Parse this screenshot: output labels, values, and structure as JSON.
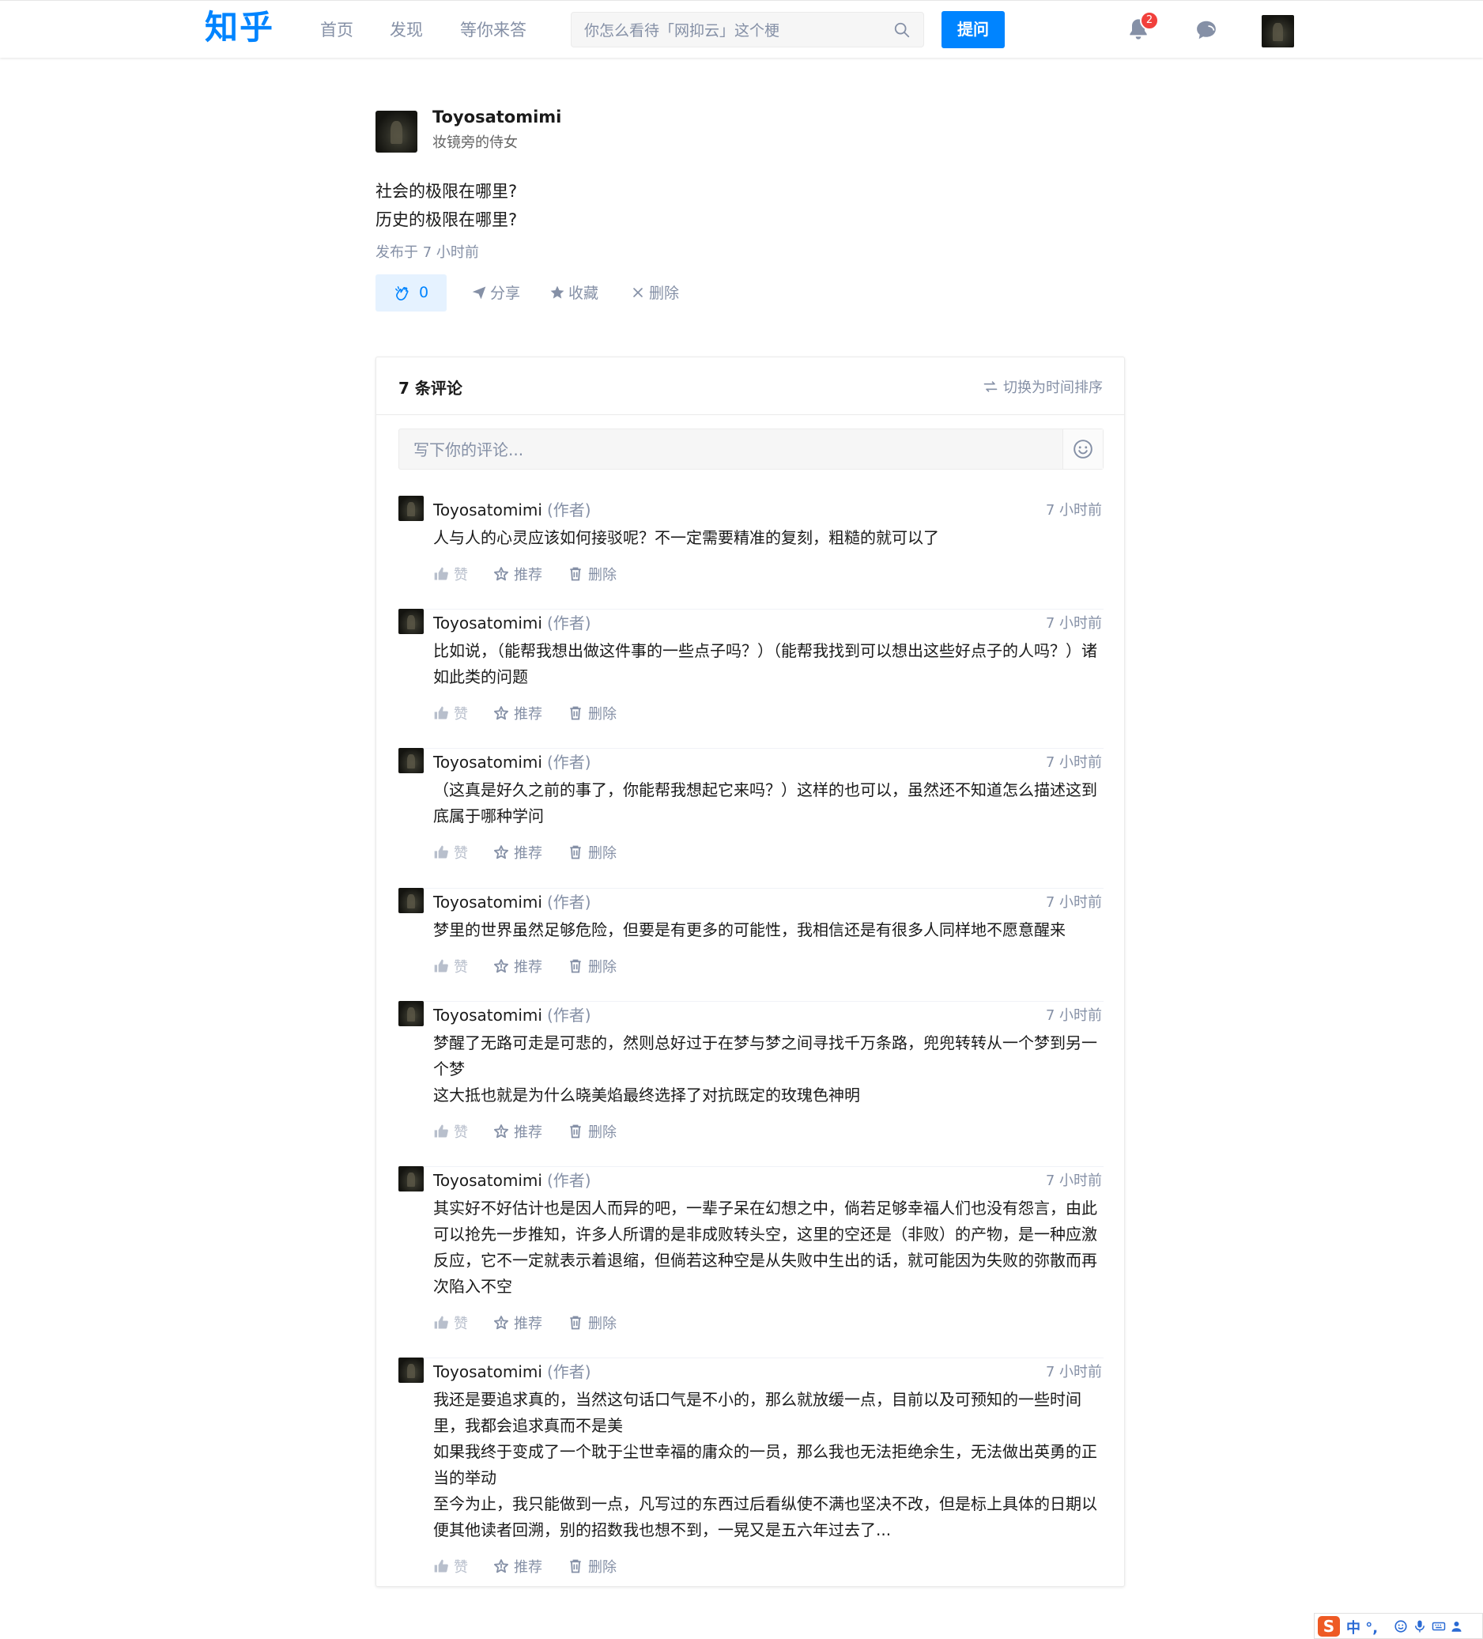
{
  "nav": {
    "logo": "知乎",
    "links": [
      "首页",
      "发现",
      "等你来答"
    ],
    "search_placeholder": "你怎么看待「网抑云」这个梗",
    "ask_label": "提问",
    "notification_count": "2"
  },
  "post": {
    "author": "Toyosatomimi",
    "headline": "妆镜旁的侍女",
    "lines": [
      "社会的极限在哪里?",
      "历史的极限在哪里?"
    ],
    "published": "发布于 7 小时前",
    "like_count": "0",
    "actions": {
      "share": "分享",
      "favorite": "收藏",
      "delete": "删除"
    }
  },
  "comments_section": {
    "title": "7 条评论",
    "sort_label": "切换为时间排序",
    "input_placeholder": "写下你的评论...",
    "action_labels": {
      "like": "赞",
      "recommend": "推荐",
      "delete": "删除"
    },
    "items": [
      {
        "author": "Toyosatomimi",
        "tag": "(作者)",
        "time": "7 小时前",
        "lines": [
          "人与人的心灵应该如何接驳呢？不一定需要精准的复刻，粗糙的就可以了"
        ]
      },
      {
        "author": "Toyosatomimi",
        "tag": "(作者)",
        "time": "7 小时前",
        "lines": [
          "比如说，（能帮我想出做这件事的一些点子吗？）（能帮我找到可以想出这些好点子的人吗？）诸如此类的问题"
        ]
      },
      {
        "author": "Toyosatomimi",
        "tag": "(作者)",
        "time": "7 小时前",
        "lines": [
          "（这真是好久之前的事了，你能帮我想起它来吗？）这样的也可以，虽然还不知道怎么描述这到底属于哪种学问"
        ]
      },
      {
        "author": "Toyosatomimi",
        "tag": "(作者)",
        "time": "7 小时前",
        "lines": [
          "梦里的世界虽然足够危险，但要是有更多的可能性，我相信还是有很多人同样地不愿意醒来"
        ]
      },
      {
        "author": "Toyosatomimi",
        "tag": "(作者)",
        "time": "7 小时前",
        "lines": [
          "梦醒了无路可走是可悲的，然则总好过于在梦与梦之间寻找千万条路，兜兜转转从一个梦到另一个梦",
          "这大抵也就是为什么晓美焰最终选择了对抗既定的玫瑰色神明"
        ]
      },
      {
        "author": "Toyosatomimi",
        "tag": "(作者)",
        "time": "7 小时前",
        "lines": [
          "其实好不好估计也是因人而异的吧，一辈子呆在幻想之中，倘若足够幸福人们也没有怨言，由此可以抢先一步推知，许多人所谓的是非成败转头空，这里的空还是（非败）的产物，是一种应激反应，它不一定就表示着退缩，但倘若这种空是从失败中生出的话，就可能因为失败的弥散而再次陷入不空"
        ]
      },
      {
        "author": "Toyosatomimi",
        "tag": "(作者)",
        "time": "7 小时前",
        "lines": [
          "我还是要追求真的，当然这句话口气是不小的，那么就放缓一点，目前以及可预知的一些时间里，我都会追求真而不是美",
          "如果我终于变成了一个耽于尘世幸福的庸众的一员，那么我也无法拒绝余生，无法做出英勇的正当的举动",
          "至今为止，我只能做到一点，凡写过的东西过后看纵使不满也坚决不改，但是标上具体的日期以便其他读者回溯，别的招数我也想不到，一晃又是五六年过去了..."
        ]
      }
    ]
  },
  "ime": {
    "label": "中 °,"
  },
  "colors": {
    "brand": "#0084ff",
    "muted": "#8590a6",
    "badge": "#f1403c"
  }
}
